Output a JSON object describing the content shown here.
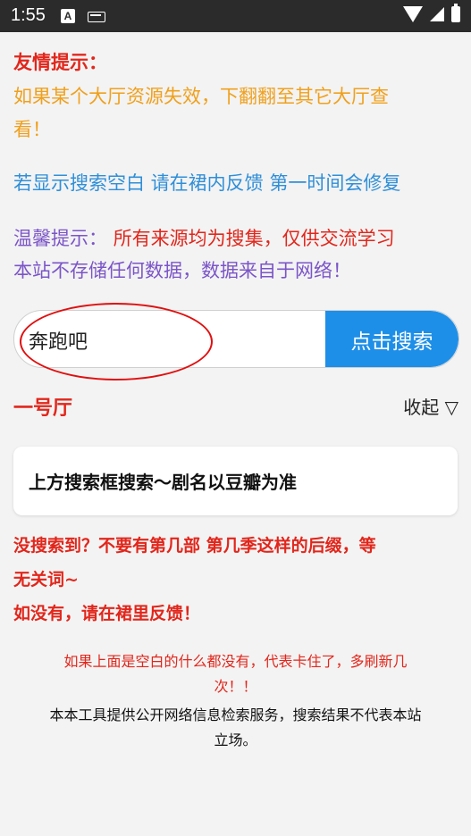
{
  "status_bar": {
    "time": "1:55",
    "notification_icon_a": "A"
  },
  "tips": {
    "title": "友情提示：",
    "line1a": "如果某个大厅资源失效，下翻翻至其它大厅查",
    "line1b": "看！",
    "feedback": "若显示搜索空白 请在裙内反馈 第一时间会修复",
    "warm_prefix": "温馨提示：",
    "warm_red": "所有来源均为搜集，仅供交流学习",
    "warm_line2": "本站不存储任何数据，数据来自于网络！"
  },
  "search": {
    "value": "奔跑吧",
    "button": "点击搜索"
  },
  "hall": {
    "title": "一号厅",
    "collapse": "收起 ▽",
    "card_text": "上方搜索框搜索～剧名以豆瓣为准"
  },
  "no_result": {
    "line1": "没搜索到？不要有第几部 第几季这样的后缀，等",
    "line2": "无关词~",
    "line3": "如没有，请在裙里反馈！"
  },
  "footer": {
    "red_line1": "如果上面是空白的什么都没有，代表卡住了，多刷新几",
    "red_line2": "次！！",
    "black_line1": "本本工具提供公开网络信息检索服务，搜索结果不代表本站",
    "black_line2": "立场。"
  },
  "colors": {
    "title_red": "#e2261b",
    "orange": "#f0a01c",
    "blue_text": "#2f8fd8",
    "purple": "#7b55c8",
    "button_blue": "#1e8fe8"
  }
}
